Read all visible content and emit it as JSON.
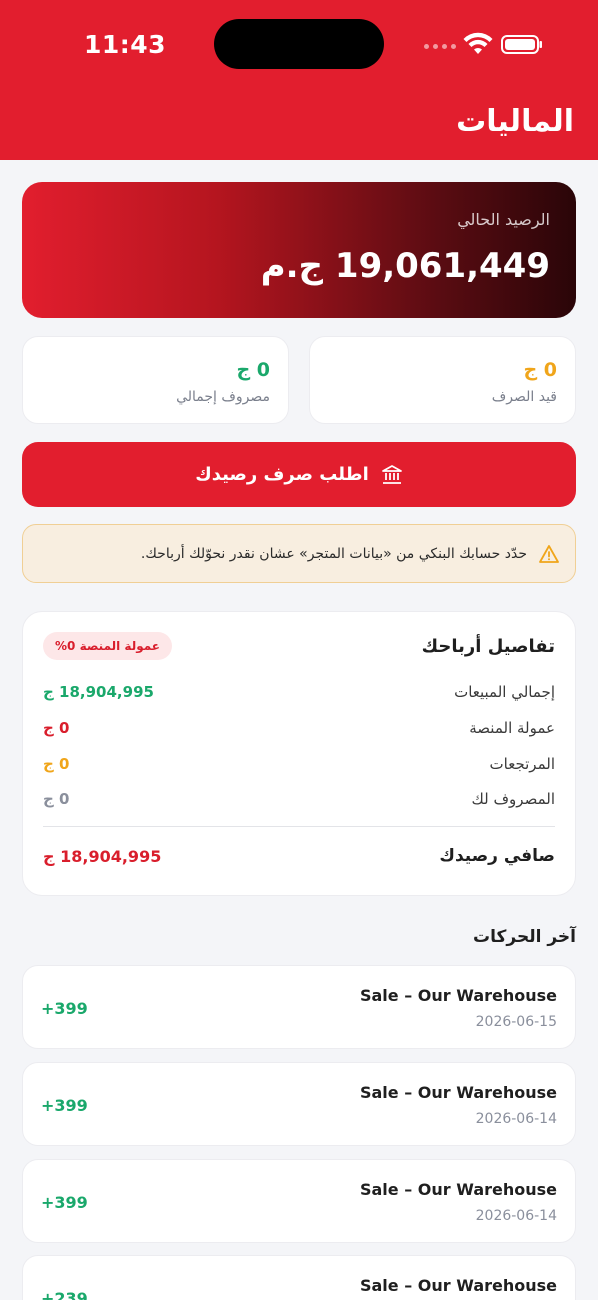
{
  "status_bar": {
    "time": "11:43"
  },
  "header": {
    "title": "الماليات"
  },
  "balance": {
    "label": "الرصيد الحالي",
    "value": "19,061,449 ج.م"
  },
  "stats": {
    "pending": {
      "value": "0 ج",
      "label": "قيد الصرف",
      "color": "#f0a51a"
    },
    "spent": {
      "value": "0 ج",
      "label": "مصروف إجمالي",
      "color": "#1aa86b"
    }
  },
  "withdraw_button": {
    "label": "اطلب صرف رصيدك",
    "icon": "bank-icon"
  },
  "warning": {
    "text": "حدّد حسابك البنكي من «بيانات المتجر» عشان نقدر نحوّلك أرباحك.",
    "icon": "warning-icon"
  },
  "details": {
    "title": "تفاصيل أرباحك",
    "badge": "عمولة المنصة 0%",
    "rows": [
      {
        "label": "إجمالي المبيعات",
        "value": "18,904,995 ج",
        "color": "#1aa86b"
      },
      {
        "label": "عمولة المنصة",
        "value": "0 ج",
        "color": "#d91e2c"
      },
      {
        "label": "المرتجعات",
        "value": "0 ج",
        "color": "#f0a51a"
      },
      {
        "label": "المصروف لك",
        "value": "0 ج",
        "color": "#8a8f9c"
      }
    ],
    "net": {
      "label": "صافي رصيدك",
      "value": "18,904,995 ج"
    }
  },
  "transactions": {
    "title": "آخر الحركات",
    "items": [
      {
        "title": "Sale – Our Warehouse",
        "date": "2026-06-15",
        "amount": "+399"
      },
      {
        "title": "Sale – Our Warehouse",
        "date": "2026-06-14",
        "amount": "+399"
      },
      {
        "title": "Sale – Our Warehouse",
        "date": "2026-06-14",
        "amount": "+399"
      },
      {
        "title": "Sale – Our Warehouse",
        "date": "",
        "amount": "+239"
      }
    ]
  },
  "colors": {
    "brand": "#e21e2e",
    "green": "#1aa86b",
    "red": "#d91e2c",
    "orange": "#f0a51a"
  }
}
